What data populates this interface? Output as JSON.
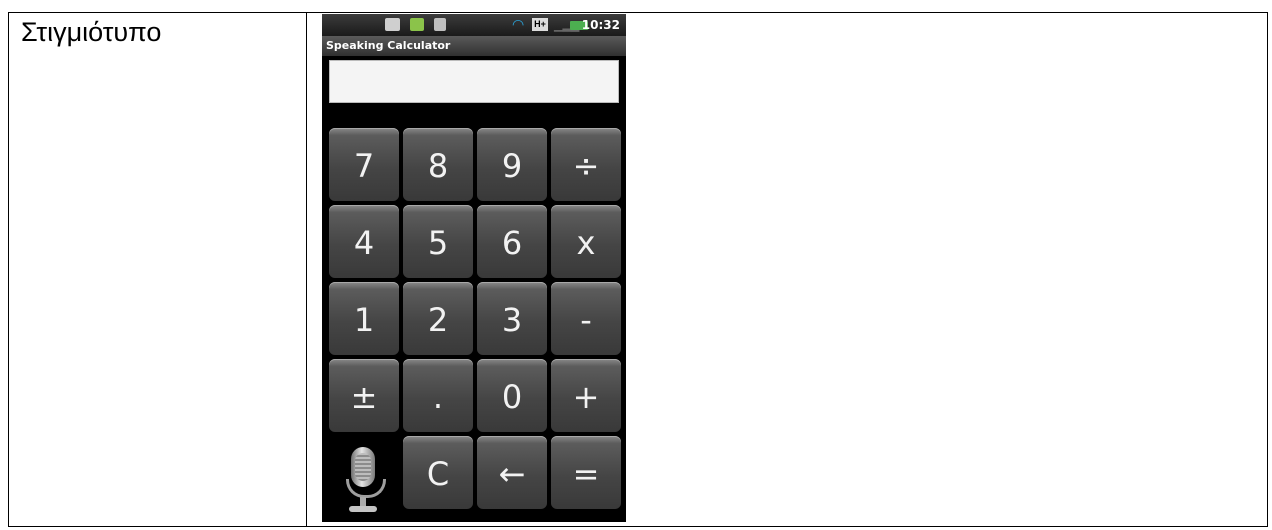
{
  "document": {
    "cell_label": "Στιγμιότυπο"
  },
  "statusbar": {
    "network_badge": "H+",
    "time": "10:32"
  },
  "app": {
    "title": "Speaking Calculator",
    "display_value": ""
  },
  "keypad": {
    "keys": [
      {
        "label": "7"
      },
      {
        "label": "8"
      },
      {
        "label": "9"
      },
      {
        "label": "÷"
      },
      {
        "label": "4"
      },
      {
        "label": "5"
      },
      {
        "label": "6"
      },
      {
        "label": "x"
      },
      {
        "label": "1"
      },
      {
        "label": "2"
      },
      {
        "label": "3"
      },
      {
        "label": "-"
      },
      {
        "label": "±"
      },
      {
        "label": "."
      },
      {
        "label": "0"
      },
      {
        "label": "+"
      },
      {
        "label": "C"
      },
      {
        "label": "←"
      },
      {
        "label": "="
      }
    ],
    "voice_icon": "microphone-icon"
  }
}
